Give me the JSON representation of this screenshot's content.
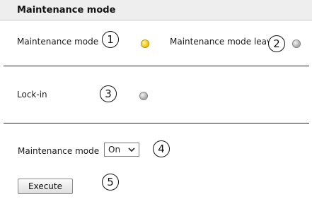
{
  "header": {
    "title": "Maintenance mode"
  },
  "status": {
    "maintenance_mode_label": "Maintenance mode",
    "maintenance_mode_led": "on",
    "maintenance_mode_leave_label": "Maintenance mode leave",
    "maintenance_mode_leave_led": "off"
  },
  "lockin": {
    "label": "Lock-in",
    "led": "off"
  },
  "control": {
    "maintenance_mode_label": "Maintenance mode",
    "select_value": "On",
    "execute_label": "Execute"
  },
  "callouts": [
    "1",
    "2",
    "3",
    "4",
    "5"
  ],
  "colors": {
    "led_on": "#f4cc1a",
    "led_off": "#b5b5b5",
    "header_bg": "#eeeeee"
  }
}
